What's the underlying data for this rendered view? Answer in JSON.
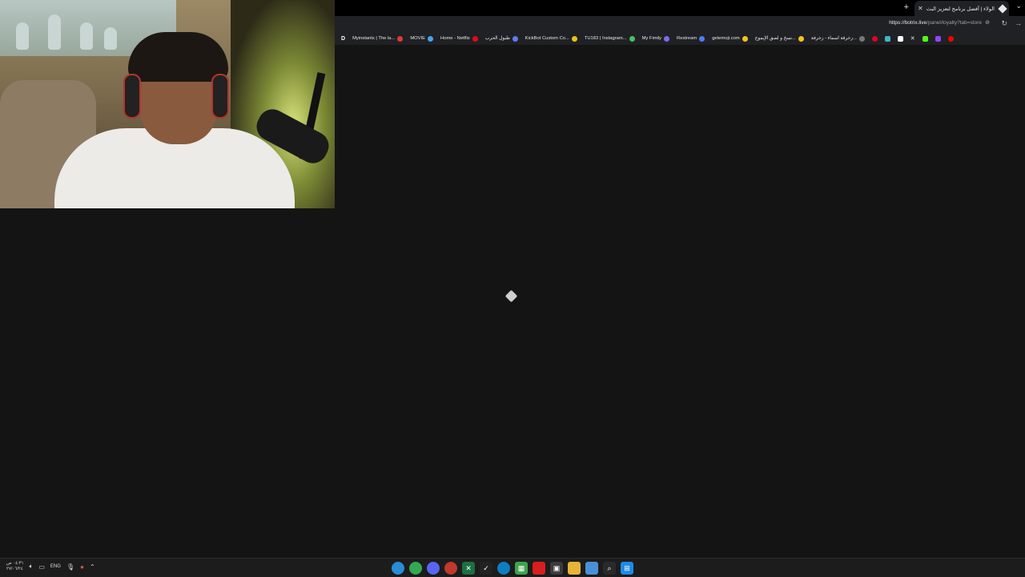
{
  "browser": {
    "tab_title": "الولاء | أفضل برنامج لتعزيز البث الم...",
    "url_host": "https://botrix.live",
    "url_path": "/panel/loyalty?tab=store",
    "icons": [
      "plus-icon",
      "close-icon",
      "chevron-down-icon",
      "reload-icon",
      "forward-icon",
      "lock-icon"
    ]
  },
  "bookmarks": [
    {
      "label": "D",
      "icon": "d-logo-icon"
    },
    {
      "label": "Myinstants | The la...",
      "icon_color": "#e53935"
    },
    {
      "label": "MOVIE",
      "icon_color": "#42a5f5"
    },
    {
      "label": "Home - Netflix",
      "icon_color": "#e50914"
    },
    {
      "label": "طبول الحرب",
      "icon_color": "#5c7cfa"
    },
    {
      "label": "KickBot Custom Co...",
      "icon_color": "#e6c619"
    },
    {
      "label": "TU183 | Instagram...",
      "icon_color": "#43c463"
    },
    {
      "label": "My Fimily",
      "icon_color": "#7b6cf6"
    },
    {
      "label": "Restream",
      "icon_color": "#4e7cf7"
    },
    {
      "label": "getemoji.com",
      "icon_color": "#f5c518"
    },
    {
      "label": "نسخ و لصق الإيموج...",
      "icon_color": "#f5c518"
    },
    {
      "label": "زخرفة اسماء - زخرفة...",
      "icon_color": "#777777"
    }
  ],
  "bookmark_extras": [
    {
      "icon": "pinterest-icon",
      "color": "#e60023"
    },
    {
      "icon": "instagram-icon",
      "color": "#3fb6c9"
    },
    {
      "icon": "tiktok-icon",
      "color": "#ffffff"
    },
    {
      "icon": "x-icon",
      "color": "#ffffff"
    },
    {
      "icon": "kick-icon",
      "color": "#53fc18"
    },
    {
      "icon": "twitch-icon",
      "color": "#9146ff"
    },
    {
      "icon": "youtube-icon",
      "color": "#ff0000"
    }
  ],
  "taskbar": {
    "language": "ENG",
    "time": "٠٤:٣١ ص",
    "date": "٢٧/٠٦/٢٤",
    "apps": [
      {
        "icon": "browser-icon",
        "color": "#2a8bd6"
      },
      {
        "icon": "chrome-icon",
        "color": "#34a853"
      },
      {
        "icon": "discord-icon",
        "color": "#5865f2"
      },
      {
        "icon": "app-icon",
        "color": "#c0392b"
      },
      {
        "icon": "excel-icon",
        "color": "#1d6f42"
      },
      {
        "icon": "capcut-icon",
        "color": "#222222"
      },
      {
        "icon": "edge-icon",
        "color": "#0f7dc2"
      },
      {
        "icon": "app-grid-icon",
        "color": "#3fa34d"
      },
      {
        "icon": "red-app-icon",
        "color": "#d81e1e"
      },
      {
        "icon": "store-icon",
        "color": "#3b3b3b"
      },
      {
        "icon": "file-explorer-icon",
        "color": "#e8b339"
      },
      {
        "icon": "photos-icon",
        "color": "#4a90d9"
      },
      {
        "icon": "search-icon",
        "color": "#2a2a2a"
      },
      {
        "icon": "windows-start-icon",
        "color": "#1f8ae5"
      }
    ]
  }
}
